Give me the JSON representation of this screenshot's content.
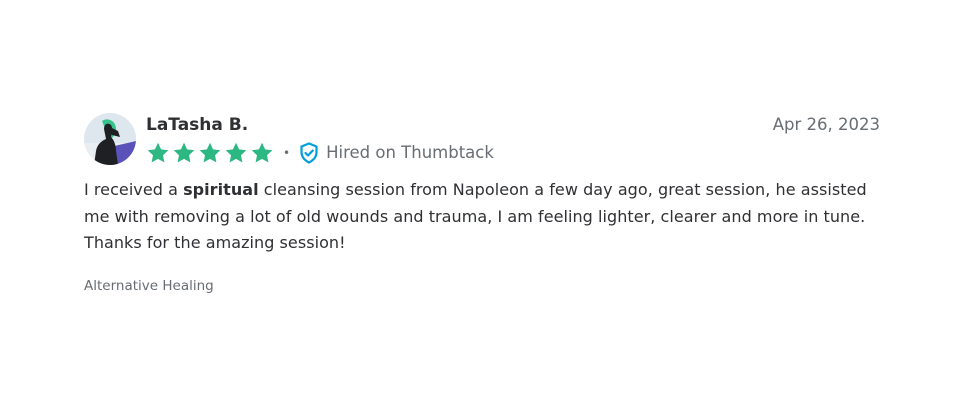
{
  "review": {
    "author": "LaTasha B.",
    "date": "Apr 26, 2023",
    "rating": 5,
    "rating_max": 5,
    "separator": "•",
    "verified_label": "Hired on Thumbtack",
    "body": {
      "before": "I received a ",
      "highlight": "spiritual",
      "after": " cleansing session from Napoleon a few day ago, great session, he assisted me with removing a lot of old wounds and trauma, I am feeling lighter, clearer and more in tune. Thanks for the amazing session!"
    },
    "category": "Alternative Healing"
  },
  "icons": {
    "star": "star-icon",
    "verified": "shield-check-icon",
    "avatar": "user-avatar"
  },
  "colors": {
    "star": "#2db783",
    "verified": "#009fd9",
    "text": "#2f3033",
    "muted": "#676d73",
    "avatar_green": "#36c48b",
    "avatar_purple": "#5a52b8",
    "avatar_bg": "#e9eef3"
  }
}
